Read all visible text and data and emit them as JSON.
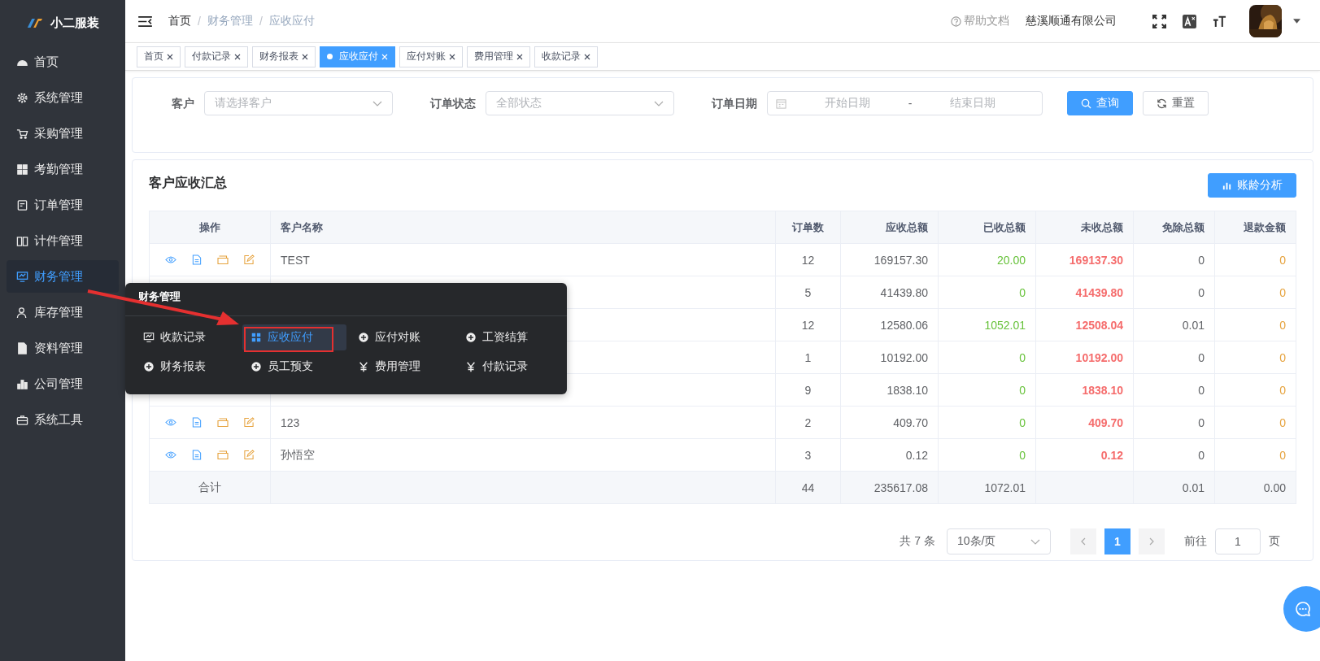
{
  "sidebar": {
    "logo": "小二服装",
    "items": [
      {
        "label": "首页",
        "kind": "gauge",
        "selected": false
      },
      {
        "label": "系统管理",
        "kind": "gear",
        "selected": false
      },
      {
        "label": "采购管理",
        "kind": "cart",
        "selected": false
      },
      {
        "label": "考勤管理",
        "kind": "grid",
        "selected": false
      },
      {
        "label": "订单管理",
        "kind": "receipt",
        "selected": false
      },
      {
        "label": "计件管理",
        "kind": "book",
        "selected": false
      },
      {
        "label": "财务管理",
        "kind": "monitor",
        "selected": true
      },
      {
        "label": "库存管理",
        "kind": "user",
        "selected": false
      },
      {
        "label": "资料管理",
        "kind": "document",
        "selected": false
      },
      {
        "label": "公司管理",
        "kind": "bars",
        "selected": false
      },
      {
        "label": "系统工具",
        "kind": "toolbox",
        "selected": false
      }
    ]
  },
  "header": {
    "breadcrumbs": [
      "首页",
      "财务管理",
      "应收应付"
    ],
    "breadcrumb_separators": [
      "/",
      "/"
    ],
    "help": "帮助文档",
    "company": "慈溪顺通有限公司"
  },
  "tags": [
    {
      "label": "首页",
      "selected": false
    },
    {
      "label": "付款记录",
      "selected": false
    },
    {
      "label": "财务报表",
      "selected": false
    },
    {
      "label": "应收应付",
      "selected": true
    },
    {
      "label": "应付对账",
      "selected": false
    },
    {
      "label": "费用管理",
      "selected": false
    },
    {
      "label": "收款记录",
      "selected": false
    }
  ],
  "filters": {
    "customer": {
      "label": "客户",
      "placeholder": "请选择客户"
    },
    "status": {
      "label": "订单状态",
      "placeholder": "全部状态"
    },
    "date": {
      "label": "订单日期",
      "start_placeholder": "开始日期",
      "separator": "-",
      "end_placeholder": "结束日期"
    },
    "search_button": "查询",
    "reset_button": "重置"
  },
  "summary": {
    "title": "客户应收汇总",
    "analysis_button": "账龄分析",
    "columns": [
      "操作",
      "客户名称",
      "订单数",
      "应收总额",
      "已收总额",
      "未收总额",
      "免除总额",
      "退款金额"
    ],
    "rows": [
      {
        "kind": "data",
        "name": "TEST",
        "orders": "12",
        "receivable": "169157.30",
        "received": "20.00",
        "unpaid": "169137.30",
        "waived": "0",
        "refund": "0"
      },
      {
        "kind": "data",
        "orders": "5",
        "receivable": "41439.80",
        "received": "0",
        "unpaid": "41439.80",
        "waived": "0",
        "refund": "0"
      },
      {
        "kind": "data",
        "orders": "12",
        "receivable": "12580.06",
        "received": "1052.01",
        "unpaid": "12508.04",
        "waived": "0.01",
        "refund": "0"
      },
      {
        "kind": "data",
        "orders": "1",
        "receivable": "10192.00",
        "received": "0",
        "unpaid": "10192.00",
        "waived": "0",
        "refund": "0"
      },
      {
        "kind": "data",
        "orders": "9",
        "receivable": "1838.10",
        "received": "0",
        "unpaid": "1838.10",
        "waived": "0",
        "refund": "0"
      },
      {
        "kind": "data",
        "name": "123",
        "orders": "2",
        "receivable": "409.70",
        "received": "0",
        "unpaid": "409.70",
        "waived": "0",
        "refund": "0"
      },
      {
        "kind": "data",
        "name": "孙悟空",
        "orders": "3",
        "receivable": "0.12",
        "received": "0",
        "unpaid": "0.12",
        "waived": "0",
        "refund": "0"
      },
      {
        "kind": "total",
        "label": "合计",
        "orders": "44",
        "receivable": "235617.08",
        "received": "1072.01",
        "waived": "0.01",
        "refund": "0.00"
      }
    ]
  },
  "pagination": {
    "total": "共 7 条",
    "page_size": "10条/页",
    "pages": [
      {
        "label": "1",
        "selected": true
      }
    ],
    "goto": "前往",
    "goto_value": "1",
    "unit": "页"
  },
  "flyout": {
    "title": "财务管理",
    "items": [
      {
        "label": "收款记录",
        "kind": "monitor",
        "selected": false
      },
      {
        "label": "应收应付",
        "kind": "grid",
        "selected": true
      },
      {
        "label": "应付对账",
        "kind": "plus",
        "selected": false
      },
      {
        "label": "工资结算",
        "kind": "plus",
        "selected": false
      },
      {
        "label": "财务报表",
        "kind": "plus",
        "selected": false
      },
      {
        "label": "员工预支",
        "kind": "plus",
        "selected": false
      },
      {
        "label": "费用管理",
        "kind": "yen",
        "selected": false
      },
      {
        "label": "付款记录",
        "kind": "yen",
        "selected": false
      }
    ]
  }
}
